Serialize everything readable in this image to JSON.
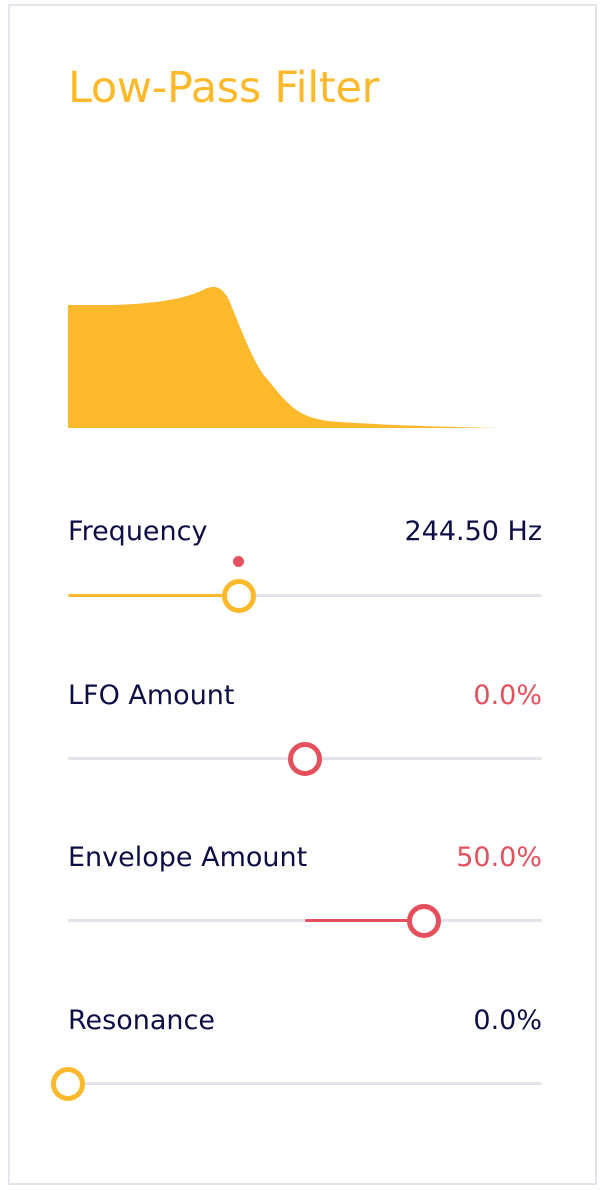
{
  "colors": {
    "accent": "#fdb92c",
    "modulation": "#e4505d",
    "text": "#0e0e47",
    "track": "#e4e5ea",
    "border": "#e4e5ea"
  },
  "title": "Low-Pass Filter",
  "graph": {
    "icon": "filter-response-curve",
    "type": "area"
  },
  "sliders": [
    {
      "id": "frequency",
      "label": "Frequency",
      "value_text": "244.50 Hz",
      "value_color": "text",
      "position": 0.36,
      "fill_from": 0,
      "fill_color": "accent",
      "thumb_color": "accent",
      "mod_dot": true,
      "mod_dot_position": 0.36
    },
    {
      "id": "lfo",
      "label": "LFO Amount",
      "value_text": "0.0%",
      "value_color": "modulation",
      "position": 0.5,
      "fill_from": 0.5,
      "fill_color": "modulation",
      "thumb_color": "modulation",
      "mod_dot": false
    },
    {
      "id": "envelope",
      "label": "Envelope Amount",
      "value_text": "50.0%",
      "value_color": "modulation",
      "position": 0.75,
      "fill_from": 0.5,
      "fill_color": "modulation",
      "thumb_color": "modulation",
      "mod_dot": false
    },
    {
      "id": "resonance",
      "label": "Resonance",
      "value_text": "0.0%",
      "value_color": "text",
      "position": 0,
      "fill_from": 0,
      "fill_color": "accent",
      "thumb_color": "accent",
      "mod_dot": false
    }
  ]
}
